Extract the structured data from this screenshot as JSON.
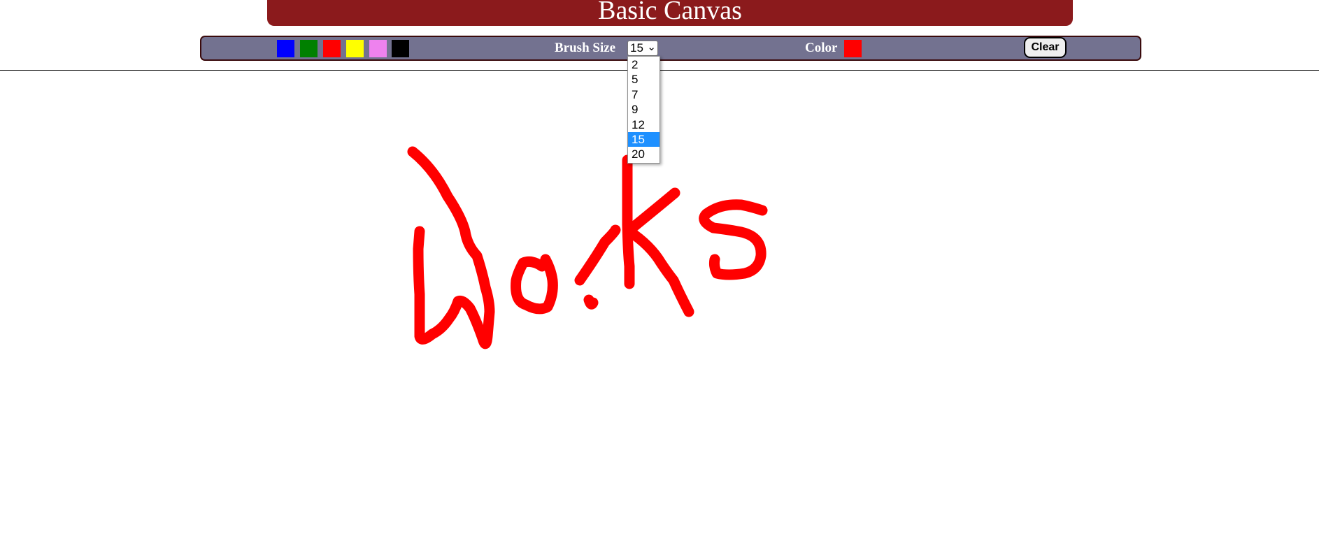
{
  "title": "Basic Canvas",
  "toolbar": {
    "palette": [
      {
        "name": "blue",
        "color": "#0000ff"
      },
      {
        "name": "green",
        "color": "#008000"
      },
      {
        "name": "red",
        "color": "#ff0000"
      },
      {
        "name": "yellow",
        "color": "#ffff00"
      },
      {
        "name": "violet",
        "color": "#ee82ee"
      },
      {
        "name": "black",
        "color": "#000000"
      }
    ],
    "brush_size_label": "Brush Size",
    "brush_size_value": "15",
    "brush_size_options": [
      "2",
      "5",
      "7",
      "9",
      "12",
      "15",
      "20"
    ],
    "color_label": "Color",
    "current_color": "#ff0000",
    "clear_label": "Clear"
  },
  "canvas": {
    "stroke_color": "#ff0000",
    "brush_size": 15
  }
}
